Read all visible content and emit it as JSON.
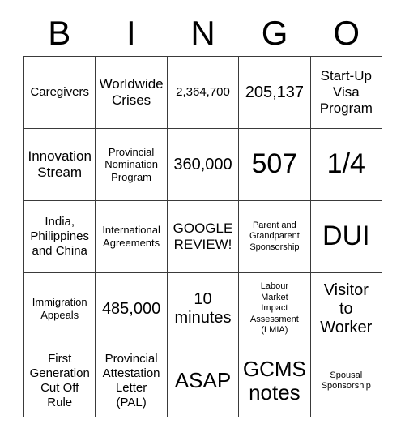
{
  "card": {
    "header_letters": [
      "B",
      "I",
      "N",
      "G",
      "O"
    ],
    "colors": {
      "background": "#ffffff",
      "text": "#000000",
      "grid_line": "#3a3a3a"
    },
    "cells": [
      {
        "text": "Caregivers",
        "size": "md"
      },
      {
        "text": "Worldwide\nCrises",
        "size": "lg"
      },
      {
        "text": "2,364,700",
        "size": "md"
      },
      {
        "text": "205,137",
        "size": "xl"
      },
      {
        "text": "Start-Up\nVisa\nProgram",
        "size": "lg"
      },
      {
        "text": "Innovation\nStream",
        "size": "lg"
      },
      {
        "text": "Provincial\nNomination\nProgram",
        "size": "sm"
      },
      {
        "text": "360,000",
        "size": "xl"
      },
      {
        "text": "507",
        "size": "huge"
      },
      {
        "text": "1/4",
        "size": "huge"
      },
      {
        "text": "India,\nPhilippines\nand China",
        "size": "md"
      },
      {
        "text": "International\nAgreements",
        "size": "sm"
      },
      {
        "text": "GOOGLE\nREVIEW!",
        "size": "lg"
      },
      {
        "text": "Parent and\nGrandparent\nSponsorship",
        "size": "xs"
      },
      {
        "text": "DUI",
        "size": "huge"
      },
      {
        "text": "Immigration\nAppeals",
        "size": "sm"
      },
      {
        "text": "485,000",
        "size": "xl"
      },
      {
        "text": "10\nminutes",
        "size": "xl"
      },
      {
        "text": "Labour\nMarket\nImpact\nAssessment\n(LMIA)",
        "size": "xs"
      },
      {
        "text": "Visitor\nto\nWorker",
        "size": "xl"
      },
      {
        "text": "First\nGeneration\nCut Off\nRule",
        "size": "md"
      },
      {
        "text": "Provincial\nAttestation\nLetter\n(PAL)",
        "size": "md"
      },
      {
        "text": "ASAP",
        "size": "xxl"
      },
      {
        "text": "GCMS\nnotes",
        "size": "xxl"
      },
      {
        "text": "Spousal\nSponsorship",
        "size": "xs"
      }
    ]
  }
}
